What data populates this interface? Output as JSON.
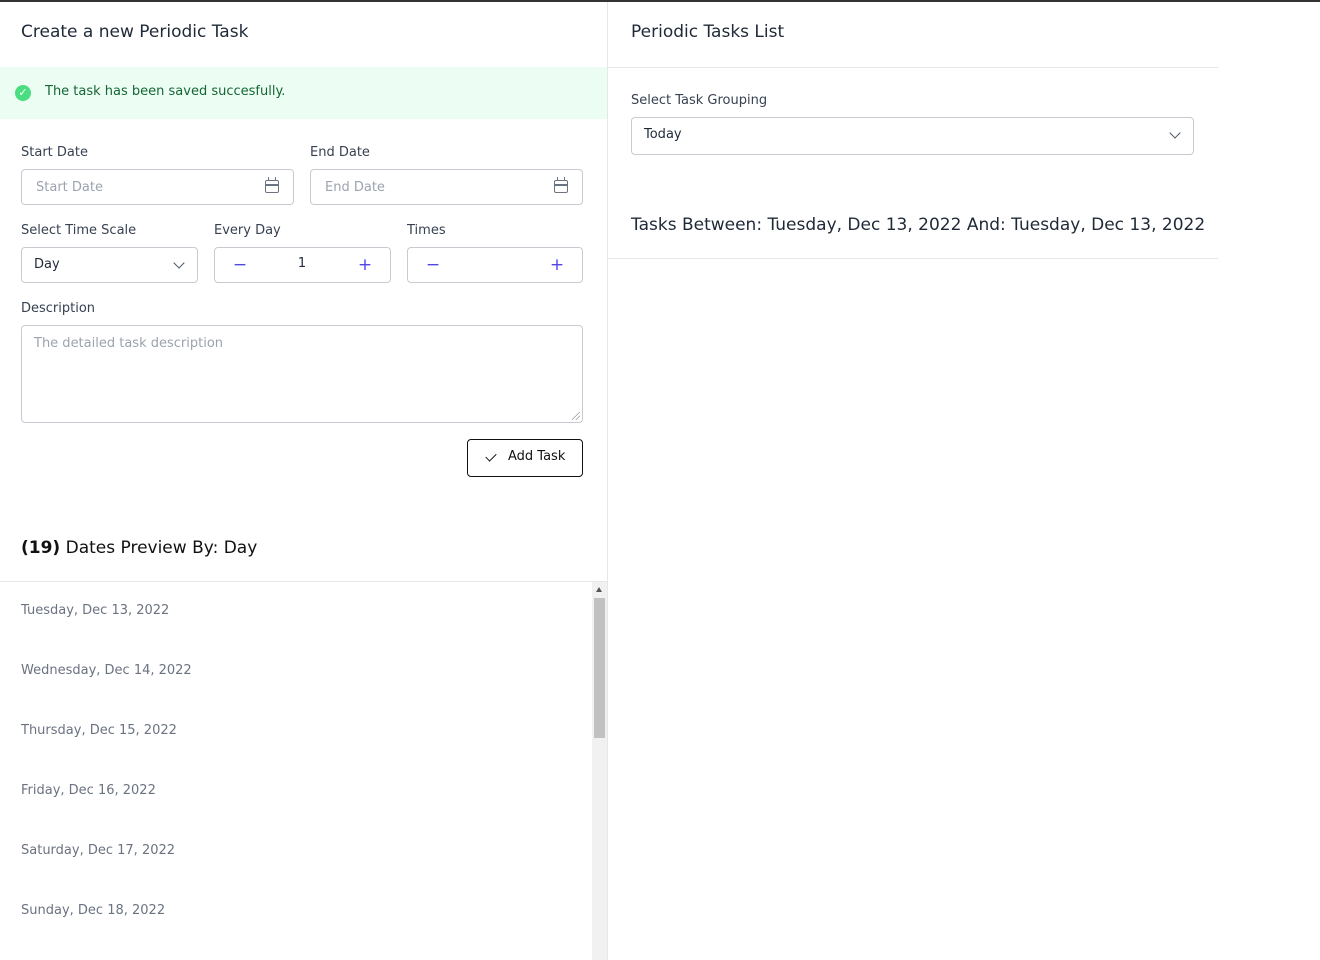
{
  "create": {
    "title": "Create a new Periodic Task",
    "alert": "The task has been saved succesfully.",
    "start_date_label": "Start Date",
    "start_date_placeholder": "Start Date",
    "end_date_label": "End Date",
    "end_date_placeholder": "End Date",
    "time_scale_label": "Select Time Scale",
    "time_scale_value": "Day",
    "every_label": "Every Day",
    "every_value": "1",
    "times_label": "Times",
    "times_value": "",
    "description_label": "Description",
    "description_placeholder": "The detailed task description",
    "add_button": "Add Task"
  },
  "preview": {
    "count": "(19)",
    "title": " Dates Preview By: Day",
    "dates": [
      "Tuesday, Dec 13, 2022",
      "Wednesday, Dec 14, 2022",
      "Thursday, Dec 15, 2022",
      "Friday, Dec 16, 2022",
      "Saturday, Dec 17, 2022",
      "Sunday, Dec 18, 2022"
    ]
  },
  "list": {
    "title": "Periodic Tasks List",
    "grouping_label": "Select Task Grouping",
    "grouping_value": "Today",
    "tasks_between": "Tasks Between: Tuesday, Dec 13, 2022 And: Tuesday, Dec 13, 2022"
  },
  "icons": {
    "success": "check-circle-icon",
    "calendar": "calendar-icon",
    "chevron": "chevron-down-icon",
    "minus": "minus-icon",
    "plus": "plus-icon",
    "check": "check-icon"
  },
  "colors": {
    "accent": "#4f46e5",
    "success_bg": "#ecfdf3",
    "success_text": "#166534",
    "success_icon": "#4ade80"
  }
}
